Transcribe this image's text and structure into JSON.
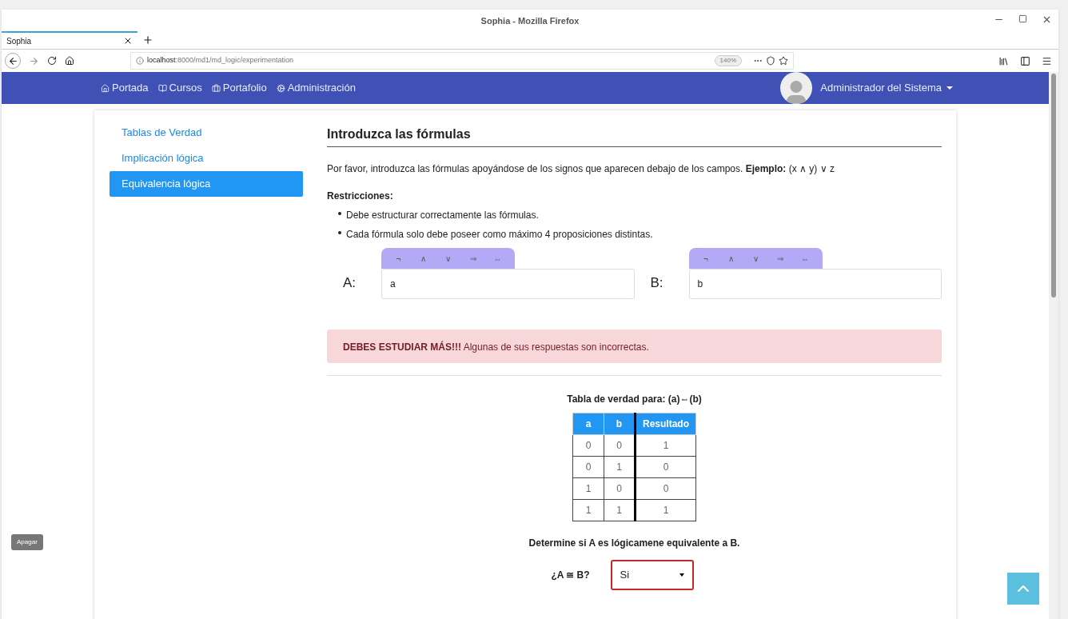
{
  "window": {
    "title": "Sophia - Mozilla Firefox"
  },
  "tabs": [
    {
      "label": "Sophia",
      "selected": true
    }
  ],
  "address_bar": {
    "url_host": "localhost",
    "url_path": ":8000/md1/md_logic/experimentation",
    "zoom": "140%"
  },
  "navbar": {
    "items": [
      {
        "label": "Portada"
      },
      {
        "label": "Cursos"
      },
      {
        "label": "Portafolio"
      },
      {
        "label": "Administración"
      }
    ],
    "user": "Administrador del Sistema"
  },
  "sidebar": {
    "items": [
      {
        "label": "Tablas de Verdad",
        "selected": false
      },
      {
        "label": "Implicación lógica",
        "selected": false
      },
      {
        "label": "Equivalencia lógica",
        "selected": true
      }
    ]
  },
  "main": {
    "heading": "Introduzca las fórmulas",
    "intro": "Por favor, introduzca las fórmulas apoyándose de los signos que aparecen debajo de los campos. **Ejemplo:** (x ∧ y) ∨ z",
    "restrictions_label": "Restricciones:",
    "restrictions": [
      "Debe estructurar correctamente las fórmulas.",
      "Cada fórmula solo debe poseer como máximo 4 proposiciones distintas."
    ],
    "formulas": [
      {
        "label": "A:",
        "symbols": [
          "¬",
          "∧",
          "∨",
          "⇒",
          "⇔"
        ],
        "value": "a"
      },
      {
        "label": "B:",
        "symbols": [
          "¬",
          "∧",
          "∨",
          "⇒",
          "⇔"
        ],
        "value": "b"
      }
    ],
    "alert": "**DEBES ESTUDIAR MÁS!!!** Algunas de sus respuestas son incorrectas.",
    "truth_table": {
      "title": "Tabla de verdad para: (a)⇔(b)",
      "columns": [
        "a",
        "b",
        "Resultado"
      ],
      "rows": [
        [
          "0",
          "0",
          "1"
        ],
        [
          "0",
          "1",
          "0"
        ],
        [
          "1",
          "0",
          "0"
        ],
        [
          "1",
          "1",
          "1"
        ]
      ]
    },
    "question": "Determine si A es lógicamene equivalente a B.",
    "answer_label": "¿A ≅ B?",
    "answer_value": "Si"
  },
  "side_tab": "Apagar"
}
